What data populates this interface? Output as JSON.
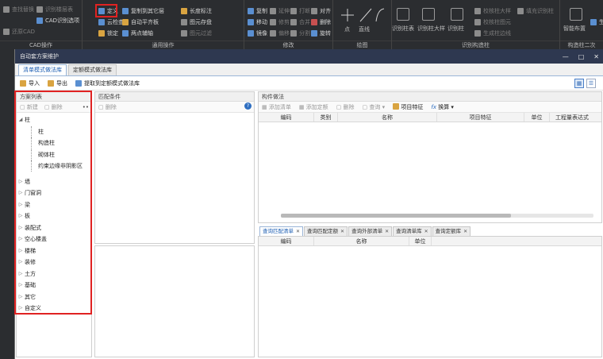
{
  "ribbon": {
    "groups": [
      {
        "label": "CAD操作",
        "items": [
          "查找替换",
          "识别楼层表",
          "CAD识别选项",
          "还原CAD"
        ]
      },
      {
        "label": "通用操作",
        "items": [
          "定义",
          "复制到其它层",
          "长度标注",
          "云检查",
          "自动平齐板",
          "图元存盘",
          "锁定",
          "两点辅轴",
          "图元过滤"
        ]
      },
      {
        "label": "修改",
        "items": [
          "复制",
          "延伸",
          "打断",
          "对齐",
          "移动",
          "修剪",
          "合并",
          "删除",
          "镜像",
          "偏移",
          "分割",
          "旋转"
        ]
      },
      {
        "label": "绘图",
        "items": [
          "点",
          "直线"
        ]
      },
      {
        "label": "识别构造柱",
        "items": [
          "识别柱表",
          "识别柱大样",
          "识别柱",
          "校核柱大样",
          "填充识别柱",
          "校核柱图元",
          "生成柱边线"
        ]
      },
      {
        "label": "构造柱二次",
        "items": [
          "智能布置",
          "生"
        ]
      }
    ]
  },
  "dialog": {
    "title": "自动套方案维护",
    "controls": [
      "—",
      "□",
      "✕"
    ],
    "tabs": [
      "清单模式做法库",
      "定额模式做法库"
    ],
    "toolbar": {
      "import": "导入",
      "export": "导出",
      "extract": "提取到定额模式做法库"
    },
    "left_panel": {
      "title": "方案列表",
      "new": "新建",
      "delete": "删除",
      "tree": [
        {
          "label": "柱",
          "expanded": true,
          "children": [
            "柱",
            "构造柱",
            "砌体柱",
            "约束边缘非阴影区"
          ]
        },
        {
          "label": "墙"
        },
        {
          "label": "门窗洞"
        },
        {
          "label": "梁"
        },
        {
          "label": "板"
        },
        {
          "label": "装配式"
        },
        {
          "label": "空心楼盖"
        },
        {
          "label": "楼梯"
        },
        {
          "label": "装修"
        },
        {
          "label": "土方"
        },
        {
          "label": "基础"
        },
        {
          "label": "其它"
        },
        {
          "label": "自定义"
        }
      ]
    },
    "mid_panel": {
      "title": "匹配条件",
      "delete": "删除",
      "search_icon": "?"
    },
    "right_panel": {
      "title": "构件做法",
      "toolbar": [
        "添加清单",
        "添加定额",
        "删除",
        "查询",
        "项目特征",
        "换算"
      ],
      "columns": [
        "编码",
        "类别",
        "名称",
        "项目特征",
        "单位",
        "工程量表达式"
      ]
    },
    "bottom_tabs": [
      "查询匹配清单",
      "查询匹配定额",
      "查询外部清单",
      "查询清单库",
      "查询定额库"
    ],
    "bottom_columns": [
      "编码",
      "名称",
      "单位"
    ]
  },
  "colors": {
    "accent": "#1e5fb3",
    "highlight": "#e02222",
    "titlebar": "#2e3850",
    "ribbon": "#2b2d30"
  }
}
